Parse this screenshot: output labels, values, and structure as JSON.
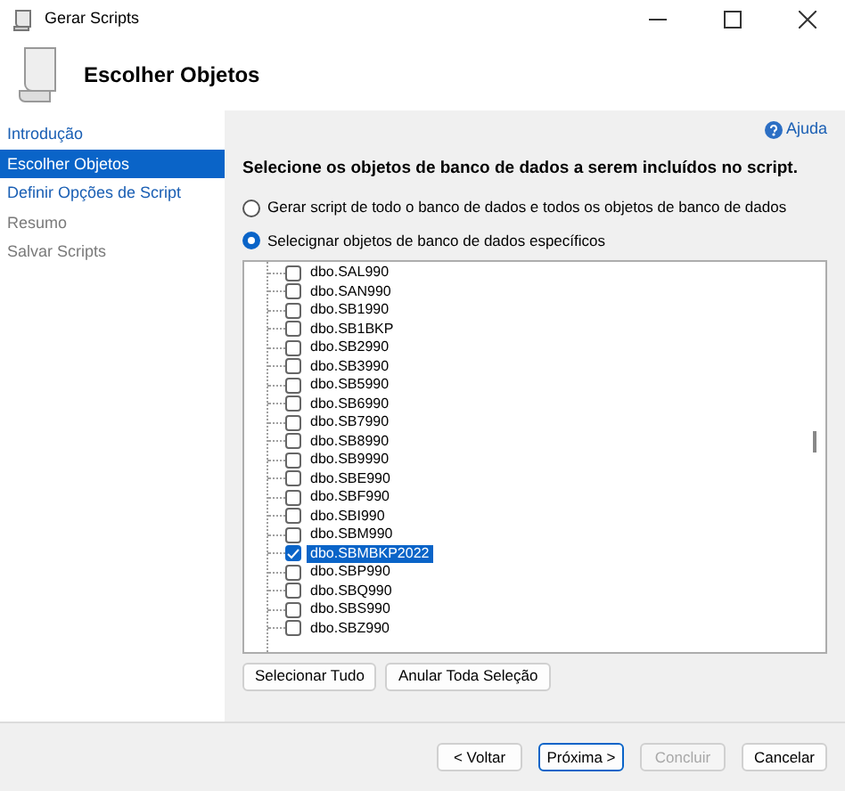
{
  "window": {
    "title": "Gerar Scripts"
  },
  "header": {
    "title": "Escolher Objetos"
  },
  "sidebar": {
    "items": [
      {
        "label": "Introdução",
        "selected": false,
        "disabled": false
      },
      {
        "label": "Escolher Objetos",
        "selected": true,
        "disabled": false
      },
      {
        "label": "Definir Opções de Script",
        "selected": false,
        "disabled": false
      },
      {
        "label": "Resumo",
        "selected": false,
        "disabled": true
      },
      {
        "label": "Salvar Scripts",
        "selected": false,
        "disabled": true
      }
    ]
  },
  "help_link": "Ajuda",
  "instruction": "Selecione os objetos de banco de dados a serem incluídos no script.",
  "options": [
    {
      "label": "Gerar script de todo o banco de dados e todos os objetos de banco de dados",
      "selected": false
    },
    {
      "label": "Selecignar objetos de banco de dados específicos",
      "selected": true
    }
  ],
  "tree": {
    "items": [
      {
        "label": "dbo.SAL990",
        "checked": false,
        "selected": false
      },
      {
        "label": "dbo.SAN990",
        "checked": false,
        "selected": false
      },
      {
        "label": "dbo.SB1990",
        "checked": false,
        "selected": false
      },
      {
        "label": "dbo.SB1BKP",
        "checked": false,
        "selected": false
      },
      {
        "label": "dbo.SB2990",
        "checked": false,
        "selected": false
      },
      {
        "label": "dbo.SB3990",
        "checked": false,
        "selected": false
      },
      {
        "label": "dbo.SB5990",
        "checked": false,
        "selected": false
      },
      {
        "label": "dbo.SB6990",
        "checked": false,
        "selected": false
      },
      {
        "label": "dbo.SB7990",
        "checked": false,
        "selected": false
      },
      {
        "label": "dbo.SB8990",
        "checked": false,
        "selected": false
      },
      {
        "label": "dbo.SB9990",
        "checked": false,
        "selected": false
      },
      {
        "label": "dbo.SBE990",
        "checked": false,
        "selected": false
      },
      {
        "label": "dbo.SBF990",
        "checked": false,
        "selected": false
      },
      {
        "label": "dbo.SBI990",
        "checked": false,
        "selected": false
      },
      {
        "label": "dbo.SBM990",
        "checked": false,
        "selected": false
      },
      {
        "label": "dbo.SBMBKP2022",
        "checked": true,
        "selected": true
      },
      {
        "label": "dbo.SBP990",
        "checked": false,
        "selected": false
      },
      {
        "label": "dbo.SBQ990",
        "checked": false,
        "selected": false
      },
      {
        "label": "dbo.SBS990",
        "checked": false,
        "selected": false
      },
      {
        "label": "dbo.SBZ990",
        "checked": false,
        "selected": false
      }
    ]
  },
  "selection_buttons": [
    "Selecionar Tudo",
    "Anular Toda Seleção"
  ],
  "footer_buttons": [
    {
      "label": "< Voltar",
      "disabled": false,
      "default": false
    },
    {
      "label": "Próxima >",
      "disabled": false,
      "default": true
    },
    {
      "label": "Concluir",
      "disabled": true,
      "default": false
    },
    {
      "label": "Cancelar",
      "disabled": false,
      "default": false
    }
  ]
}
